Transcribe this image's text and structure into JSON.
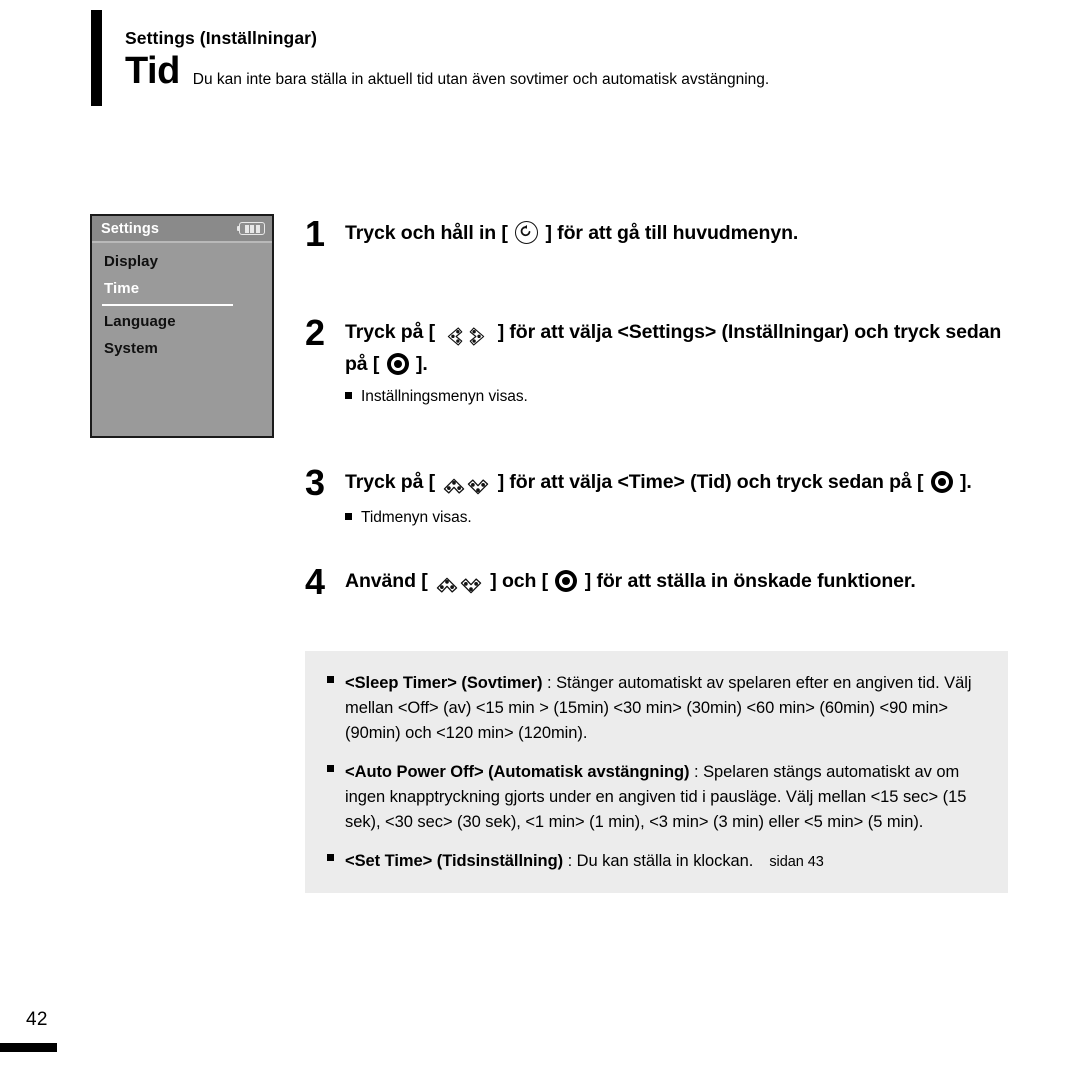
{
  "header": {
    "eyebrow": "Settings (Inställningar)",
    "title": "Tid",
    "description": "Du kan inte bara ställa in aktuell tid utan även sovtimer och automatisk avstängning."
  },
  "device_screen": {
    "title": "Settings",
    "battery_icon": "battery-icon",
    "items": [
      {
        "label": "Display",
        "selected": false
      },
      {
        "label": "Time",
        "selected": true
      },
      {
        "label": "Language",
        "selected": false
      },
      {
        "label": "System",
        "selected": false
      }
    ]
  },
  "steps": [
    {
      "number": "1",
      "text_before": "Tryck och håll in [",
      "icon": "return-arrow-icon",
      "text_after": "] för att gå till huvudmenyn.",
      "note": null
    },
    {
      "number": "2",
      "text_a": "Tryck på [",
      "icon_a": "left-right-chevron-icon",
      "text_b": "] för att välja <Settings> (Inställningar) och tryck sedan på [",
      "icon_b": "select-button-icon",
      "text_c": "].",
      "note": "Inställningsmenyn visas."
    },
    {
      "number": "3",
      "text_a": "Tryck på [",
      "icon_a": "up-down-chevron-icon",
      "text_b": "] för att välja <Time> (Tid) och tryck sedan på [",
      "icon_b": "select-button-icon",
      "text_c": "].",
      "note": "Tidmenyn visas."
    },
    {
      "number": "4",
      "text_a": "Använd [",
      "icon_a": "up-down-chevron-icon",
      "text_b": "] och [",
      "icon_b": "select-button-icon",
      "text_c": "] för att ställa in önskade funktioner.",
      "note": null
    }
  ],
  "infobox": {
    "items": [
      {
        "term": "<Sleep Timer> (Sovtimer)",
        "body": " : Stänger automatiskt av spelaren efter en angiven tid. Välj mellan <Off> (av) <15 min > (15min) <30 min> (30min) <60 min> (60min) <90 min> (90min) och <120 min> (120min)."
      },
      {
        "term": "<Auto Power Off> (Automatisk avstängning)",
        "body": " : Spelaren stängs automatiskt av om ingen knapptryckning gjorts under en angiven tid i pausläge. Välj mellan <15 sec> (15 sek), <30 sec> (30 sek), <1 min> (1 min), <3 min> (3 min) eller <5 min> (5 min)."
      },
      {
        "term": "<Set Time> (Tidsinställning)",
        "body": " : Du kan ställa in klockan.",
        "pageref": "sidan 43"
      }
    ]
  },
  "footer": {
    "page_number": "42"
  },
  "colors": {
    "device_body": "#9a9a9a",
    "device_titlebar": "#8a8a8a",
    "infobox_bg": "#ececec",
    "ink": "#000000"
  }
}
